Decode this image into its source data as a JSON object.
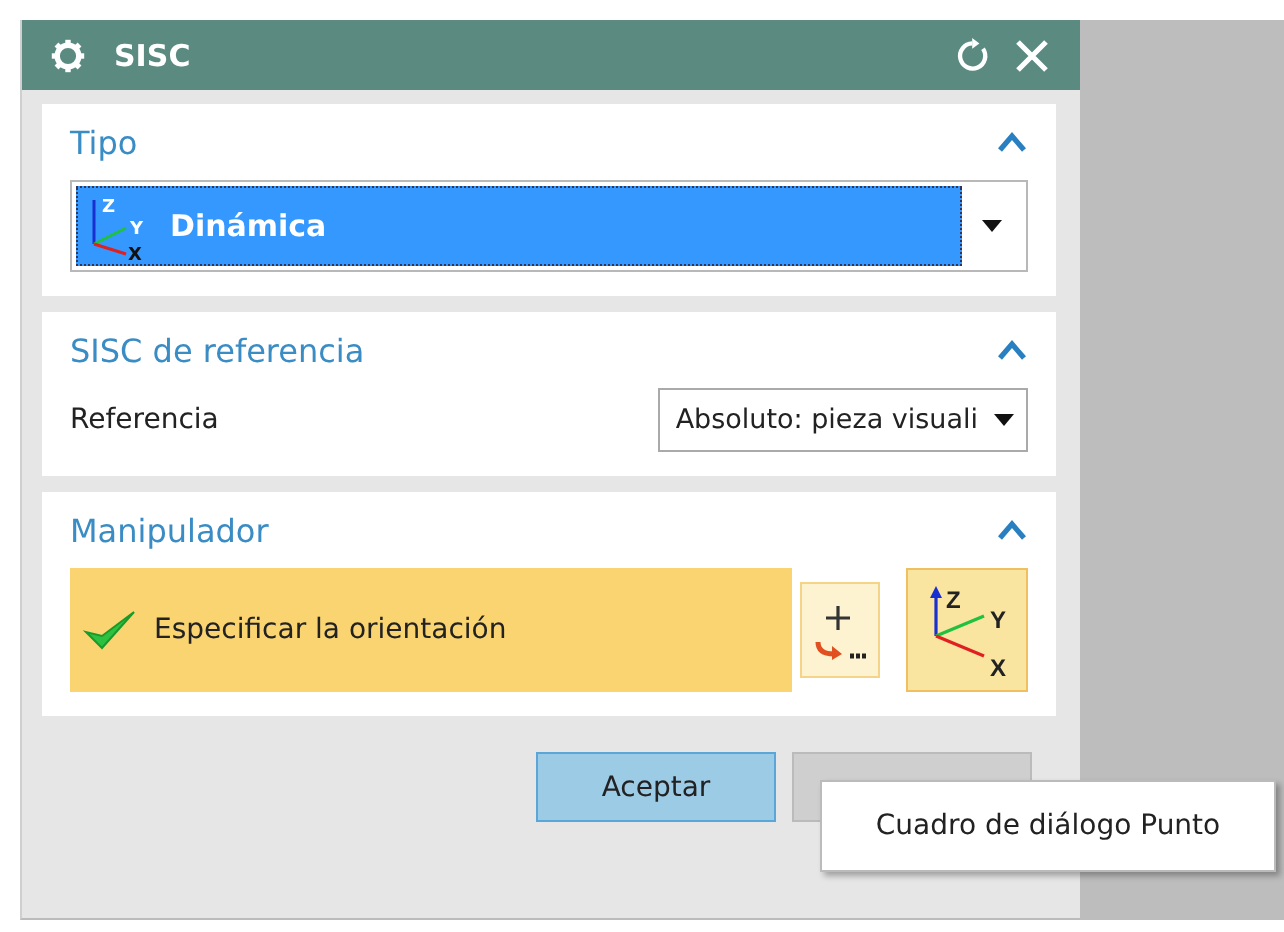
{
  "window": {
    "title": "SISC"
  },
  "sections": [
    {
      "kind": "type",
      "title": "Tipo",
      "expanded": true,
      "dropdown": {
        "value": "Dinámica",
        "axis_labels": [
          "Z",
          "Y",
          "X"
        ]
      }
    },
    {
      "kind": "reference",
      "title": "SISC de referencia",
      "expanded": true,
      "label": "Referencia",
      "dropdown": {
        "value": "Absoluto: pieza visuali"
      }
    },
    {
      "kind": "manipulator",
      "title": "Manipulador",
      "expanded": true,
      "step": {
        "label": "Especificar la orientación",
        "done": true
      },
      "axis_labels": [
        "Z",
        "Y",
        "X"
      ]
    }
  ],
  "buttons": [
    {
      "label": "Aceptar",
      "kind": "primary"
    },
    {
      "kind": "hidden"
    }
  ],
  "tooltip": "Cuadro de diálogo Punto"
}
